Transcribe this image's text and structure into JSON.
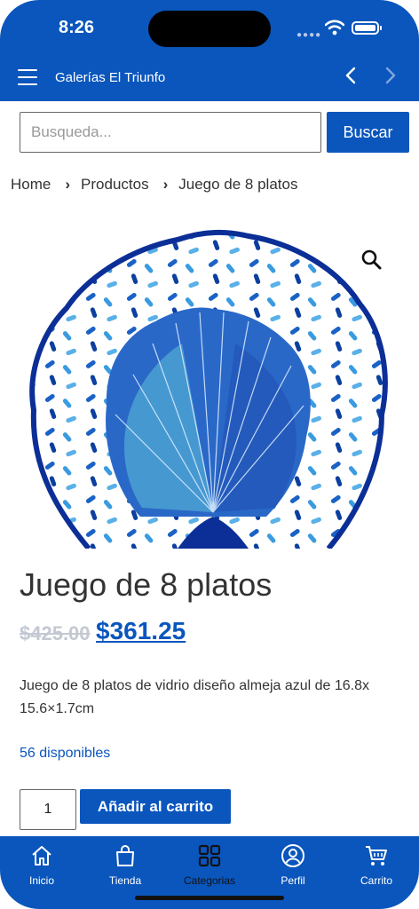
{
  "status_bar": {
    "time": "8:26"
  },
  "header": {
    "title": "Galerías El Triunfo"
  },
  "search": {
    "placeholder": "Busqueda...",
    "button_label": "Buscar"
  },
  "breadcrumb": [
    "Home",
    "Productos",
    "Juego de 8 platos"
  ],
  "product": {
    "title": "Juego de 8 platos",
    "old_price": "$425.00",
    "new_price": "$361.25",
    "description": "Juego de 8 platos de vidrio diseño almeja azul de 16.8x 15.6×1.7cm",
    "stock": "56 disponibles",
    "quantity": "1",
    "add_to_cart_label": "Añadir al carrito"
  },
  "bottom_nav": [
    {
      "label": "Inicio",
      "icon": "home-icon"
    },
    {
      "label": "Tienda",
      "icon": "shopping-bag-icon"
    },
    {
      "label": "Categorias",
      "icon": "grid-icon",
      "active": true
    },
    {
      "label": "Perfil",
      "icon": "user-icon"
    },
    {
      "label": "Carrito",
      "icon": "cart-icon"
    }
  ],
  "colors": {
    "brand": "#0a56bd",
    "sale_old": "#c3c8d2",
    "text": "#333333"
  }
}
